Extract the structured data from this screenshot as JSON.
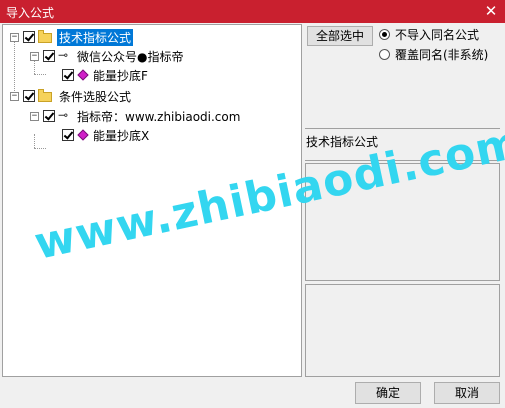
{
  "window": {
    "title": "导入公式",
    "close_glyph": "✕"
  },
  "tree": {
    "root1": {
      "label": "技术指标公式",
      "checked": true,
      "expanded": true
    },
    "root1_child": {
      "label": "微信公众号●指标帝",
      "checked": true
    },
    "root1_leaf": {
      "label": "能量抄底F",
      "checked": true
    },
    "root2": {
      "label": "条件选股公式",
      "checked": true,
      "expanded": true
    },
    "root2_child": {
      "label": "指标帝：www.zhibiaodi.com",
      "checked": true
    },
    "root2_leaf": {
      "label": "能量抄底X",
      "checked": true
    },
    "toggle_glyph": "−"
  },
  "options": {
    "select_all_label": "全部选中",
    "radio1_label": "不导入同名公式",
    "radio2_label": "覆盖同名(非系统)",
    "selected_radio": 1
  },
  "detail": {
    "header": "技术指标公式"
  },
  "buttons": {
    "ok_label": "确定",
    "cancel_label": "取消"
  },
  "watermark": {
    "text": "www.zhibiaodi.com",
    "color": "#33d6f0"
  }
}
